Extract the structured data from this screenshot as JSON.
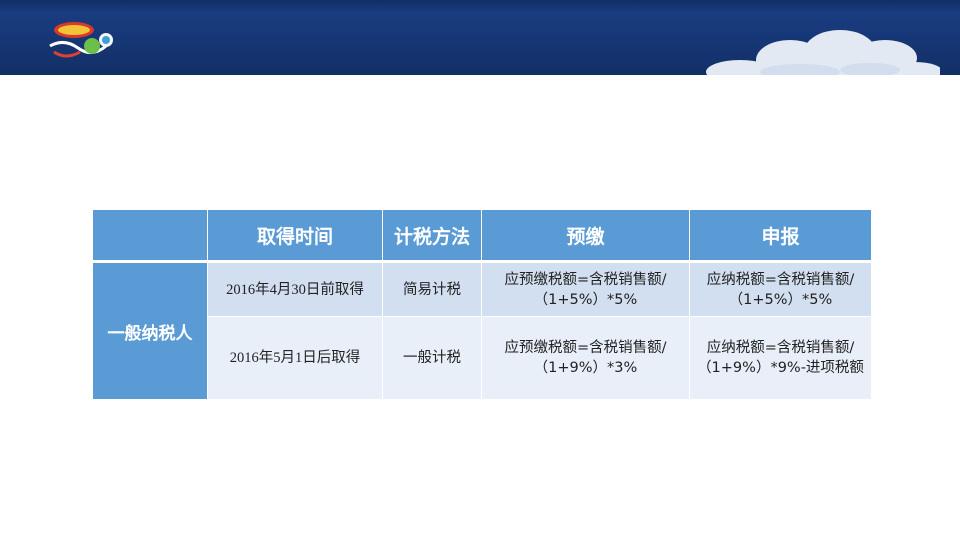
{
  "header": {
    "colors": {
      "banner": "#173878",
      "header_cells": "#5b9bd5",
      "row_light": "#d2dff0",
      "row_lighter": "#e9eff8"
    }
  },
  "table": {
    "headers": [
      "",
      "取得时间",
      "计税方法",
      "预缴",
      "申报"
    ],
    "row_label": "一般纳税人",
    "rows": [
      {
        "acquired": "2016年4月30日前取得",
        "method": "简易计税",
        "prepay": "应预缴税额=含税销售额/（1+5%）*5%",
        "declare": "应纳税额=含税销售额/（1+5%）*5%"
      },
      {
        "acquired": "2016年5月1日后取得",
        "method": "一般计税",
        "prepay": "应预缴税额=含税销售额/（1+9%）*3%",
        "declare": "应纳税额=含税销售额/（1+9%）*9%-进项税额"
      }
    ]
  }
}
